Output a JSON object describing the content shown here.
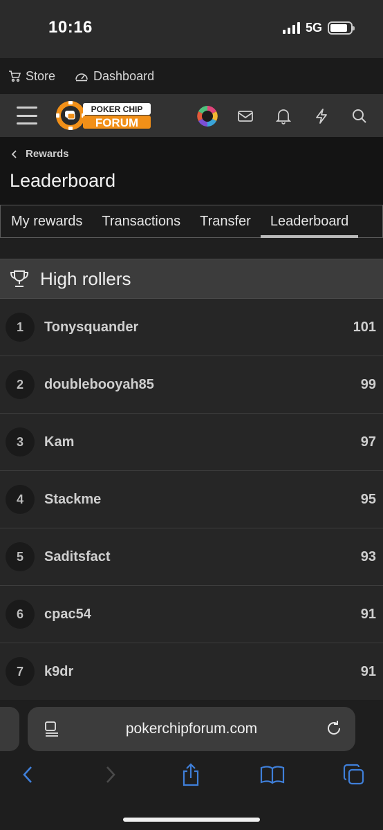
{
  "status": {
    "time": "10:16",
    "network": "5G"
  },
  "toplinks": {
    "store": "Store",
    "dashboard": "Dashboard"
  },
  "logo": {
    "line1": "POKER CHIP",
    "line2": "FORUM"
  },
  "breadcrumb": {
    "label": "Rewards"
  },
  "page": {
    "title": "Leaderboard"
  },
  "tabs": [
    "My rewards",
    "Transactions",
    "Transfer",
    "Leaderboard"
  ],
  "active_tab": "Leaderboard",
  "block": {
    "title": "High rollers"
  },
  "leaderboard": [
    {
      "rank": "1",
      "name": "Tonysquander",
      "score": "101"
    },
    {
      "rank": "2",
      "name": "doublebooyah85",
      "score": "99"
    },
    {
      "rank": "3",
      "name": "Kam",
      "score": "97"
    },
    {
      "rank": "4",
      "name": "Stackme",
      "score": "95"
    },
    {
      "rank": "5",
      "name": "Saditsfact",
      "score": "93"
    },
    {
      "rank": "6",
      "name": "cpac54",
      "score": "91"
    },
    {
      "rank": "7",
      "name": "k9dr",
      "score": "91"
    }
  ],
  "browser": {
    "url": "pokerchipforum.com"
  },
  "colors": {
    "accent": "#f29018",
    "ios_blue": "#3f7fd9"
  }
}
